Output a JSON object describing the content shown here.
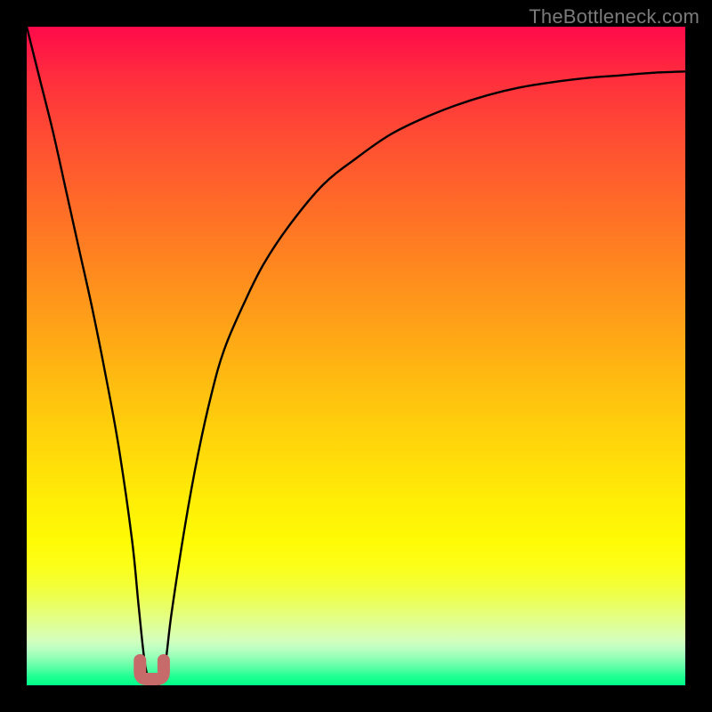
{
  "watermark": "TheBottleneck.com",
  "chart_data": {
    "type": "line",
    "title": "",
    "xlabel": "",
    "ylabel": "",
    "xlim": [
      0,
      100
    ],
    "ylim": [
      0,
      100
    ],
    "grid": false,
    "legend": false,
    "series": [
      {
        "name": "bottleneck-curve",
        "x": [
          0,
          2,
          4,
          6,
          8,
          10,
          12,
          14,
          16,
          17,
          18,
          19,
          20,
          21,
          22,
          24,
          26,
          28,
          30,
          33,
          36,
          40,
          45,
          50,
          55,
          60,
          65,
          70,
          75,
          80,
          85,
          90,
          95,
          100
        ],
        "values": [
          100,
          92,
          84,
          75,
          66,
          57,
          47,
          36,
          22,
          12,
          3,
          0,
          0,
          3,
          11,
          24,
          35,
          44,
          51,
          58,
          64,
          70,
          76,
          80,
          83.5,
          86,
          88,
          89.6,
          90.8,
          91.6,
          92.2,
          92.6,
          93,
          93.2
        ]
      }
    ],
    "marker": {
      "name": "optimal-region",
      "x_range": [
        17.2,
        20.8
      ],
      "y": 0,
      "color": "#c76a6a"
    }
  },
  "colors": {
    "curve_stroke": "#000000",
    "marker_stroke": "#c76a6a",
    "frame": "#000000"
  }
}
